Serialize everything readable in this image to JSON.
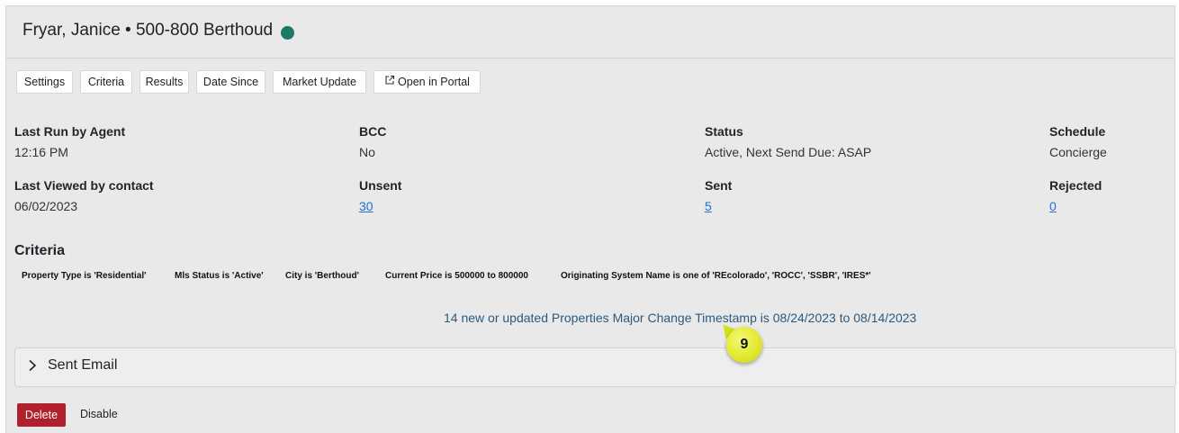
{
  "header": {
    "title": "Fryar, Janice • 500-800 Berthoud",
    "status_color": "#1a7a62"
  },
  "toolbar": {
    "settings": "Settings",
    "criteria": "Criteria",
    "results": "Results",
    "date_since": "Date Since",
    "market_update": "Market Update",
    "open_in_portal": "Open in Portal",
    "open_in_portal_icon": "external-link-icon"
  },
  "stats": {
    "last_run_label": "Last Run by Agent",
    "last_run_value": "12:16 PM",
    "bcc_label": "BCC",
    "bcc_value": "No",
    "status_label": "Status",
    "status_value": "Active, Next Send Due: ASAP",
    "schedule_label": "Schedule",
    "schedule_value": "Concierge",
    "last_viewed_label": "Last Viewed by contact",
    "last_viewed_value": "06/02/2023",
    "unsent_label": "Unsent",
    "unsent_value": "30",
    "sent_label": "Sent",
    "sent_value": "5",
    "rejected_label": "Rejected",
    "rejected_value": "0"
  },
  "criteria": {
    "heading": "Criteria",
    "items": [
      "Property Type is 'Residential'",
      "Mls Status is 'Active'",
      "City is 'Berthoud'",
      "Current Price is 500000 to 800000",
      "Originating System Name is one of 'REcolorado', 'ROCC', 'SSBR', 'IRES*'"
    ]
  },
  "summary": "14 new or updated Properties Major Change Timestamp is 08/24/2023 to 08/14/2023",
  "callout": "9",
  "accordion": {
    "label": "Sent Email"
  },
  "actions": {
    "delete": "Delete",
    "disable": "Disable",
    "delete_color": "#b0202d"
  }
}
